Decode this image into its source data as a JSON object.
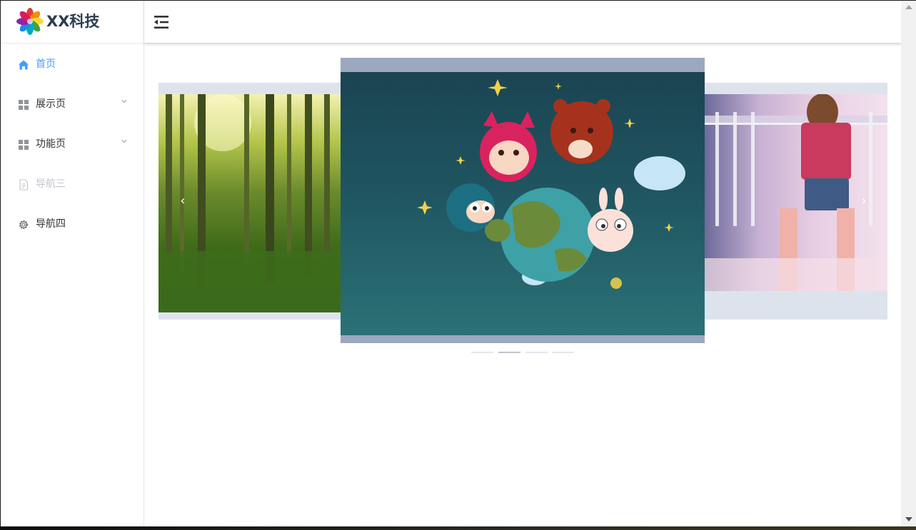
{
  "app": {
    "brand": "XX科技"
  },
  "sidebar": {
    "items": [
      {
        "label": "首页",
        "icon": "home-icon",
        "state": "active"
      },
      {
        "label": "展示页",
        "icon": "grid-icon",
        "state": "normal",
        "expandable": true
      },
      {
        "label": "功能页",
        "icon": "grid-icon",
        "state": "normal",
        "expandable": true
      },
      {
        "label": "导航三",
        "icon": "document-icon",
        "state": "disabled"
      },
      {
        "label": "导航四",
        "icon": "gear-icon",
        "state": "normal"
      }
    ]
  },
  "header": {
    "toggle_icon": "menu-fold-icon"
  },
  "carousel": {
    "type": "card",
    "slides": [
      {
        "subject": "forest"
      },
      {
        "subject": "cartoon-characters-globe"
      },
      {
        "subject": "person-photo"
      },
      {
        "subject": "hidden"
      }
    ],
    "active_index": 1,
    "indicator_count": 4,
    "prev_glyph": "‹",
    "next_glyph": "›"
  },
  "colors": {
    "accent": "#409eff",
    "text": "#303133",
    "disabled": "#c0c4cc",
    "brand_text": "#2c3e50"
  }
}
